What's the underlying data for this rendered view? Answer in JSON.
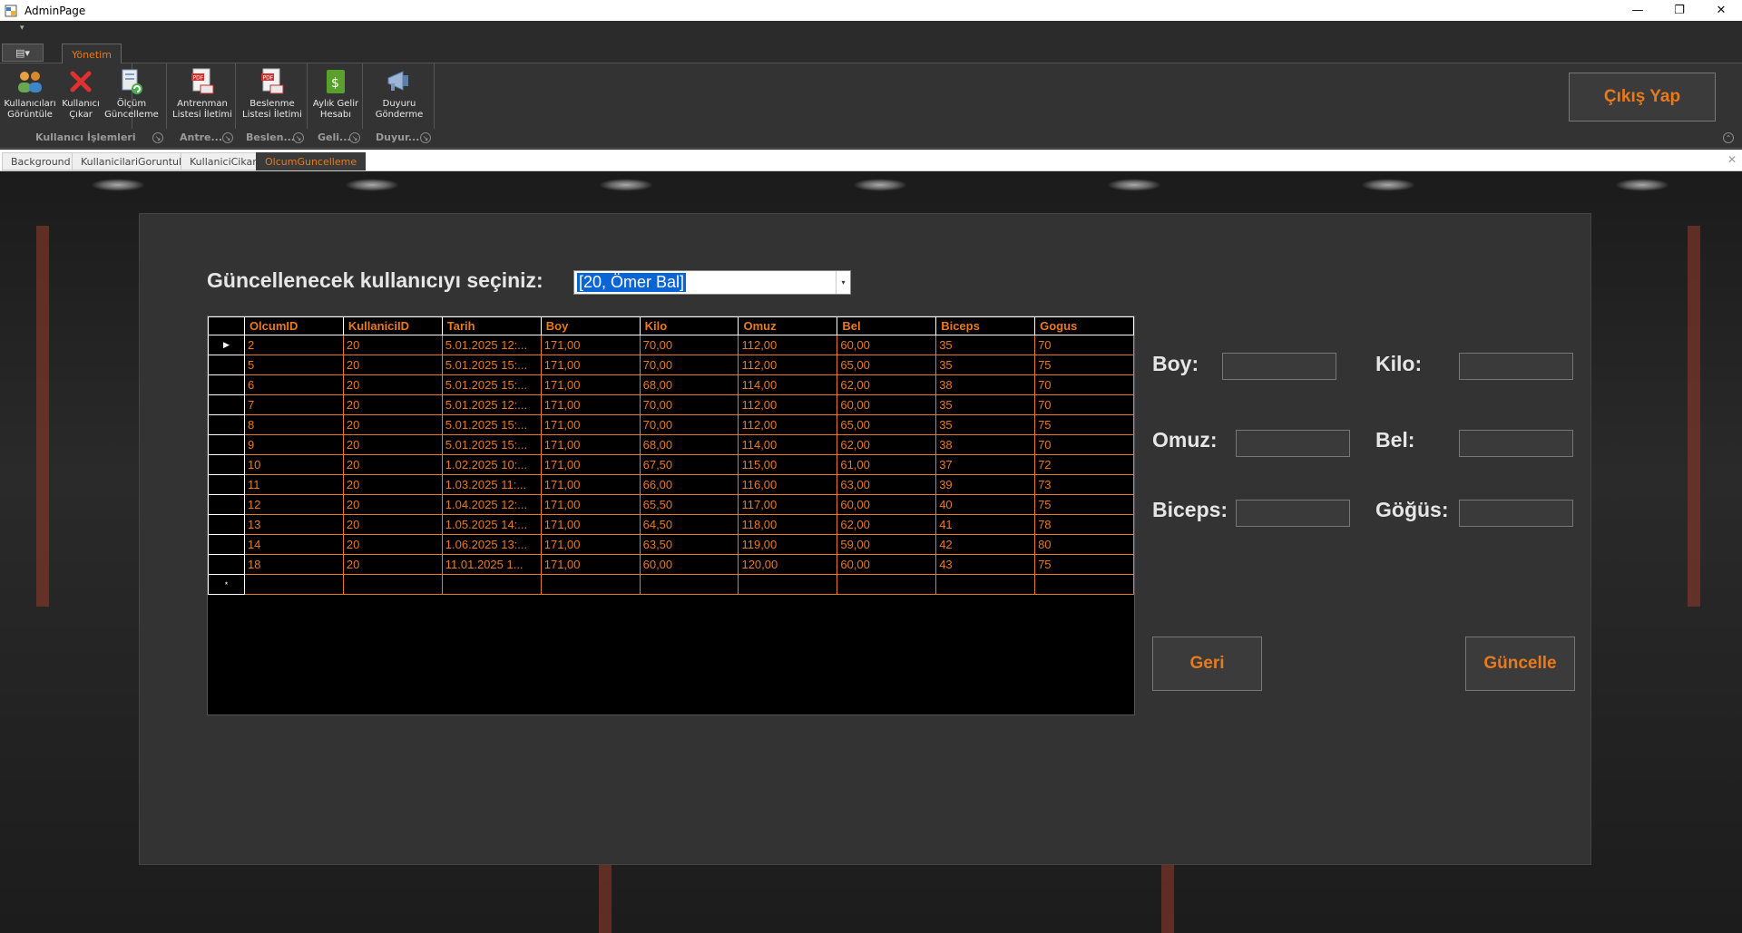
{
  "window": {
    "title": "AdminPage",
    "minimize": "—",
    "maximize": "❐",
    "close": "✕"
  },
  "qat": {
    "arrow": "▾"
  },
  "ribbon": {
    "app_menu_glyph": "▤▾",
    "tab": "Yönetim",
    "buttons": [
      {
        "line1": "Kullanıcıları",
        "line2": "Görüntüle",
        "icon": "users-icon"
      },
      {
        "line1": "Kullanıcı",
        "line2": "Çıkar",
        "icon": "delete-x-icon"
      },
      {
        "line1": "Ölçüm",
        "line2": "Güncelleme",
        "icon": "document-refresh-icon"
      },
      {
        "line1": "Antrenman",
        "line2": "Listesi İletimi",
        "icon": "pdf-mail-icon"
      },
      {
        "line1": "Beslenme",
        "line2": "Listesi İletimi",
        "icon": "pdf-mail-icon"
      },
      {
        "line1": "Aylık Gelir",
        "line2": "Hesabı",
        "icon": "money-icon"
      },
      {
        "line1": "Duyuru",
        "line2": "Gönderme",
        "icon": "megaphone-icon"
      }
    ],
    "groups": [
      "Kullanıcı İşlemleri",
      "Antre...",
      "Beslen...",
      "Geli...",
      "Duyur..."
    ],
    "expander": "↘",
    "collapse": "⌃",
    "exit_label": "Çıkış Yap"
  },
  "doc_tabs": [
    "Background",
    "KullanicilariGoruntule",
    "KullaniciCikar",
    "OlcumGuncelleme"
  ],
  "doc_close": "✕",
  "form": {
    "prompt": "Güncellenecek kullanıcıyı seçiniz:",
    "combo_value": "[20, Ömer Bal]",
    "combo_arrow": "▾",
    "grid": {
      "columns": [
        "OlcumID",
        "KullaniciID",
        "Tarih",
        "Boy",
        "Kilo",
        "Omuz",
        "Bel",
        "Biceps",
        "Gogus"
      ],
      "current_row_marker": "▶",
      "new_row_marker": "*",
      "rows": [
        [
          "2",
          "20",
          "5.01.2025 12:...",
          "171,00",
          "70,00",
          "112,00",
          "60,00",
          "35",
          "70"
        ],
        [
          "5",
          "20",
          "5.01.2025 15:...",
          "171,00",
          "70,00",
          "112,00",
          "65,00",
          "35",
          "75"
        ],
        [
          "6",
          "20",
          "5.01.2025 15:...",
          "171,00",
          "68,00",
          "114,00",
          "62,00",
          "38",
          "70"
        ],
        [
          "7",
          "20",
          "5.01.2025 12:...",
          "171,00",
          "70,00",
          "112,00",
          "60,00",
          "35",
          "70"
        ],
        [
          "8",
          "20",
          "5.01.2025 15:...",
          "171,00",
          "70,00",
          "112,00",
          "65,00",
          "35",
          "75"
        ],
        [
          "9",
          "20",
          "5.01.2025 15:...",
          "171,00",
          "68,00",
          "114,00",
          "62,00",
          "38",
          "70"
        ],
        [
          "10",
          "20",
          "1.02.2025 10:...",
          "171,00",
          "67,50",
          "115,00",
          "61,00",
          "37",
          "72"
        ],
        [
          "11",
          "20",
          "1.03.2025 11:...",
          "171,00",
          "66,00",
          "116,00",
          "63,00",
          "39",
          "73"
        ],
        [
          "12",
          "20",
          "1.04.2025 12:...",
          "171,00",
          "65,50",
          "117,00",
          "60,00",
          "40",
          "75"
        ],
        [
          "13",
          "20",
          "1.05.2025 14:...",
          "171,00",
          "64,50",
          "118,00",
          "62,00",
          "41",
          "78"
        ],
        [
          "14",
          "20",
          "1.06.2025 13:...",
          "171,00",
          "63,50",
          "119,00",
          "59,00",
          "42",
          "80"
        ],
        [
          "18",
          "20",
          "11.01.2025 1...",
          "171,00",
          "60,00",
          "120,00",
          "60,00",
          "43",
          "75"
        ]
      ]
    },
    "fields": {
      "boy": {
        "label": "Boy:",
        "value": ""
      },
      "kilo": {
        "label": "Kilo:",
        "value": ""
      },
      "omuz": {
        "label": "Omuz:",
        "value": ""
      },
      "bel": {
        "label": "Bel:",
        "value": ""
      },
      "biceps": {
        "label": "Biceps:",
        "value": ""
      },
      "gogus": {
        "label": "Göğüs:",
        "value": ""
      }
    },
    "back_label": "Geri",
    "update_label": "Güncelle"
  },
  "colors": {
    "accent": "#e87a1b",
    "panel": "#333333",
    "grid_bg": "#000000",
    "selection": "#0a64d6"
  }
}
